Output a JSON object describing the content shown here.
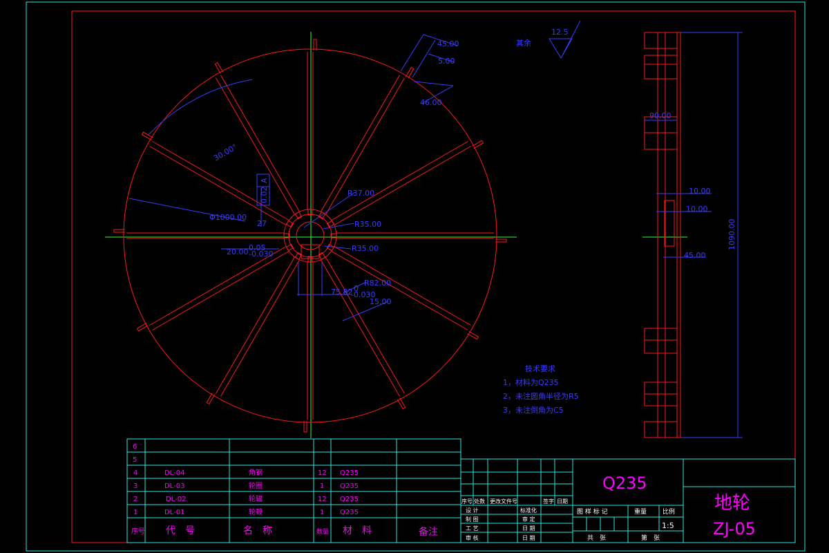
{
  "colors": {
    "background": "#000000",
    "part": "#ff1a1a",
    "frame": "#34e6e6",
    "dimension": "#3b3bff",
    "text": "#ff00ff",
    "centerline": "#33ff33"
  },
  "front_view": {
    "dims": {
      "d_outer": "Φ1000.00",
      "angle": "30.00°",
      "tol_box": "0.02",
      "datum": "A",
      "d_27": "27",
      "r37": "R37.00",
      "r35a": "R35.00",
      "r35b": "R35.00",
      "r82": "R82.00",
      "w20": "20.00",
      "w20_upper": "0.05",
      "w20_lower": "-0.030",
      "w75": "75.82",
      "w75_upper": "0",
      "w75_lower": "-0.030",
      "w15": "15.00",
      "d45": "45.00",
      "d5": "5.00",
      "d46": "46.00"
    }
  },
  "roughness": {
    "label": "其余",
    "value": "12.5"
  },
  "side_view": {
    "dims": {
      "w90": "90.00",
      "w10a": "10.00",
      "w10b": "10.00",
      "w45": "45.00",
      "h1090": "1090.00"
    }
  },
  "tech_requirements": {
    "title": "技术要求",
    "items": [
      "1，材料为Q235",
      "2，未注圆角半径为R5",
      "3，未注倒角为C5"
    ]
  },
  "bom": {
    "empty_rows": [
      "6",
      "5"
    ],
    "rows": [
      {
        "no": "4",
        "code": "DL-04",
        "name": "角钢",
        "qty": "12",
        "material": "Q235"
      },
      {
        "no": "3",
        "code": "DL-03",
        "name": "轮圈",
        "qty": "1",
        "material": "Q235"
      },
      {
        "no": "2",
        "code": "DL-02",
        "name": "轮辐",
        "qty": "12",
        "material": "Q235"
      },
      {
        "no": "1",
        "code": "DL-01",
        "name": "轮毂",
        "qty": "1",
        "material": "Q235"
      }
    ],
    "header": {
      "no": "序号",
      "code": "代　号",
      "name": "名　称",
      "qty": "数量",
      "material": "材　料",
      "note": "备注"
    }
  },
  "title_block": {
    "material": "Q235",
    "part_name": "地轮",
    "drawing_no": "ZJ-05",
    "scale": "1:5",
    "rev_headers": [
      "序号",
      "处数",
      "更改文件号",
      "签字",
      "日期"
    ],
    "sign_rows": [
      {
        "left": "设 计",
        "mid": "标准化"
      },
      {
        "left": "制 图",
        "mid": "审 定"
      },
      {
        "left": "工 艺",
        "mid": "日 期"
      },
      {
        "left": "审 核",
        "mid": "日 期"
      }
    ],
    "stage_label": "图 样 标 记",
    "weight_label": "重量",
    "scale_label": "比例",
    "total_label": "共　张",
    "sheet_label": "第　张"
  }
}
